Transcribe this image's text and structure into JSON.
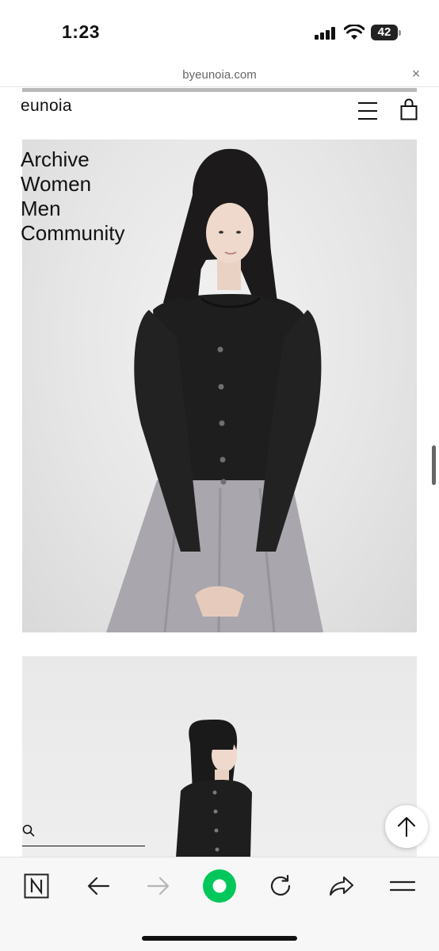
{
  "status_bar": {
    "time": "1:23",
    "battery_level": "42"
  },
  "browser": {
    "url": "byeunoia.com",
    "close_label": "×"
  },
  "header": {
    "brand": "eunoia"
  },
  "nav": {
    "items": [
      "Archive",
      "Women",
      "Men",
      "Community"
    ]
  },
  "toolbar": {
    "accent": "#03C75A"
  },
  "icons": {
    "menu": "hamburger-menu-icon",
    "cart": "shopping-bag-icon",
    "search": "search-icon",
    "scroll_top": "arrow-up-icon",
    "naver": "naver-n-icon",
    "back": "arrow-left-icon",
    "forward": "arrow-right-icon",
    "reload": "reload-icon",
    "share": "share-icon",
    "more": "more-menu-icon"
  }
}
